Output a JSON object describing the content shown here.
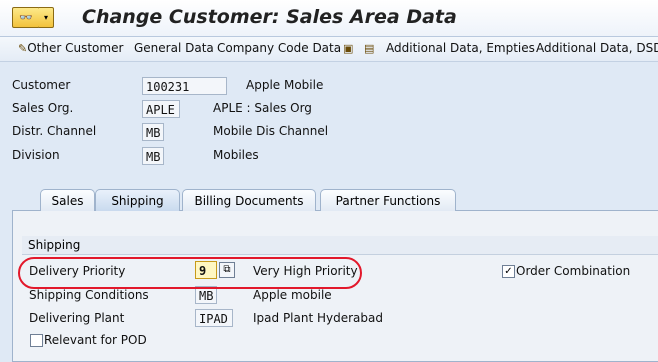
{
  "title": "Change Customer: Sales Area Data",
  "title_icon": "glasses-menu-icon",
  "toolbar": {
    "other_customer": "Other Customer",
    "general_data": "General Data",
    "company_code_data": "Company Code Data",
    "additional_data_empties": "Additional Data, Empties",
    "additional_data_dsd": "Additional Data, DSD"
  },
  "header": {
    "customer_label": "Customer",
    "customer_value": "100231",
    "customer_desc": "Apple Mobile",
    "sales_org_label": "Sales Org.",
    "sales_org_value": "APLE",
    "sales_org_desc": "APLE : Sales Org",
    "distr_channel_label": "Distr. Channel",
    "distr_channel_value": "MB",
    "distr_channel_desc": "Mobile Dis Channel",
    "division_label": "Division",
    "division_value": "MB",
    "division_desc": "Mobiles"
  },
  "tabs": [
    {
      "label": "Sales"
    },
    {
      "label": "Shipping"
    },
    {
      "label": "Billing Documents"
    },
    {
      "label": "Partner Functions"
    }
  ],
  "shipping": {
    "group_title": "Shipping",
    "delivery_priority_label": "Delivery Priority",
    "delivery_priority_value": "9",
    "delivery_priority_desc": "Very High Priority",
    "order_combination_label": "Order Combination",
    "order_combination_checked": true,
    "shipping_conditions_label": "Shipping Conditions",
    "shipping_conditions_value": "MB",
    "shipping_conditions_desc": "Apple mobile",
    "delivering_plant_label": "Delivering Plant",
    "delivering_plant_value": "IPAD",
    "delivering_plant_desc": "Ipad Plant Hyderabad",
    "relevant_pod_label": "Relevant for POD",
    "relevant_pod_checked": false
  },
  "colors": {
    "highlight": "#e2182b",
    "background": "#dfe9f5"
  }
}
